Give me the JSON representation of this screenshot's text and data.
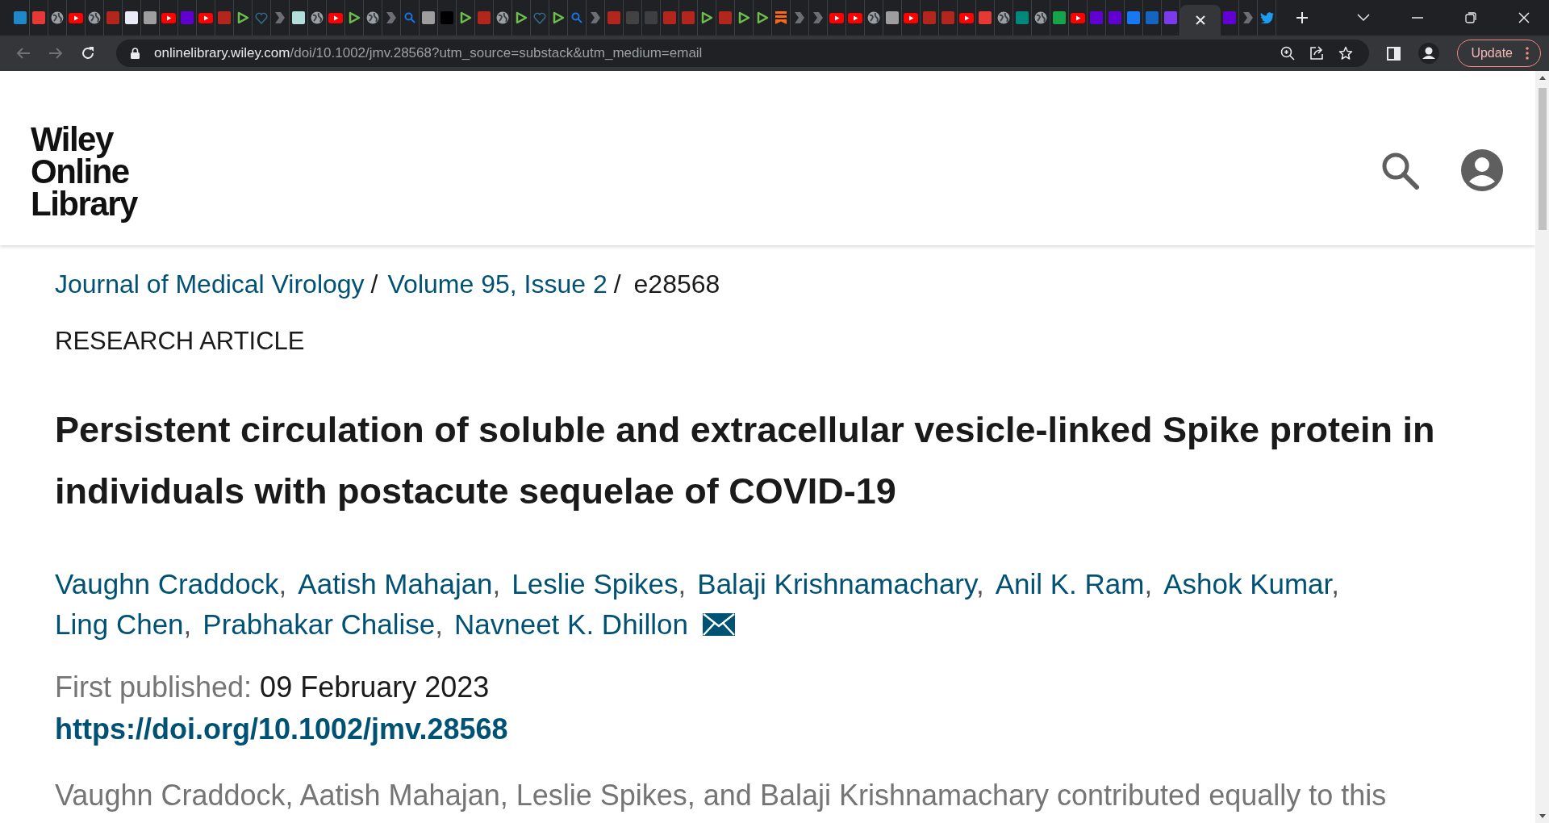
{
  "tabs": [
    {
      "kind": "tile",
      "color": "#1e88c8",
      "selected": false
    },
    {
      "kind": "tile",
      "color": "#e53935",
      "selected": false
    },
    {
      "kind": "globe",
      "selected": false
    },
    {
      "kind": "video",
      "selected": false
    },
    {
      "kind": "globe",
      "selected": false
    },
    {
      "kind": "tile",
      "color": "#b3261e",
      "selected": false
    },
    {
      "kind": "tile",
      "color": "#e8eaf6",
      "selected": false
    },
    {
      "kind": "tile",
      "color": "#9e9e9e",
      "selected": false
    },
    {
      "kind": "video",
      "selected": false
    },
    {
      "kind": "tile",
      "color": "#6001d2",
      "selected": false
    },
    {
      "kind": "video",
      "selected": false
    },
    {
      "kind": "tile",
      "color": "#b3261e",
      "selected": false
    },
    {
      "kind": "play",
      "selected": false
    },
    {
      "kind": "heart",
      "selected": false
    },
    {
      "kind": "chevron",
      "selected": false
    },
    {
      "kind": "tile",
      "color": "#b2dfdb",
      "selected": false
    },
    {
      "kind": "globe",
      "selected": false
    },
    {
      "kind": "video",
      "selected": false
    },
    {
      "kind": "play",
      "selected": false
    },
    {
      "kind": "globe",
      "selected": false
    },
    {
      "kind": "chevron",
      "selected": false
    },
    {
      "kind": "magnifier",
      "selected": false
    },
    {
      "kind": "tile",
      "color": "#9e9e9e",
      "selected": false
    },
    {
      "kind": "tile",
      "color": "#000000",
      "selected": false
    },
    {
      "kind": "play",
      "selected": false
    },
    {
      "kind": "tile",
      "color": "#b3261e",
      "selected": false
    },
    {
      "kind": "globe",
      "selected": false
    },
    {
      "kind": "play",
      "selected": false
    },
    {
      "kind": "heart",
      "selected": false
    },
    {
      "kind": "play",
      "selected": false
    },
    {
      "kind": "magnifier",
      "selected": false
    },
    {
      "kind": "chevron",
      "selected": false
    },
    {
      "kind": "tile",
      "color": "#b3261e",
      "selected": false
    },
    {
      "kind": "tile",
      "color": "#424242",
      "selected": false
    },
    {
      "kind": "tile",
      "color": "#3c4043",
      "selected": false
    },
    {
      "kind": "tile",
      "color": "#b3261e",
      "selected": false
    },
    {
      "kind": "tile",
      "color": "#b3261e",
      "selected": false
    },
    {
      "kind": "play",
      "selected": false
    },
    {
      "kind": "tile",
      "color": "#b3261e",
      "selected": false
    },
    {
      "kind": "play",
      "selected": false
    },
    {
      "kind": "play",
      "selected": false
    },
    {
      "kind": "bookmark",
      "selected": false
    },
    {
      "kind": "chevron",
      "selected": false
    },
    {
      "kind": "chevron",
      "selected": false
    },
    {
      "kind": "video",
      "selected": false
    },
    {
      "kind": "video",
      "selected": false
    },
    {
      "kind": "globe",
      "selected": false
    },
    {
      "kind": "tile",
      "color": "#9e9e9e",
      "selected": false
    },
    {
      "kind": "video",
      "selected": false
    },
    {
      "kind": "tile",
      "color": "#b3261e",
      "selected": false
    },
    {
      "kind": "tile",
      "color": "#b3261e",
      "selected": false
    },
    {
      "kind": "video",
      "selected": false
    },
    {
      "kind": "tile",
      "color": "#e53935",
      "selected": false
    },
    {
      "kind": "globe",
      "selected": false
    },
    {
      "kind": "tile",
      "color": "#00897b",
      "selected": false
    },
    {
      "kind": "globe",
      "selected": false
    },
    {
      "kind": "tile",
      "color": "#16a34a",
      "selected": false
    },
    {
      "kind": "video",
      "selected": false
    },
    {
      "kind": "tile",
      "color": "#6001d2",
      "selected": false
    },
    {
      "kind": "tile",
      "color": "#6001d2",
      "selected": false
    },
    {
      "kind": "tile",
      "color": "#1877f2",
      "selected": false
    },
    {
      "kind": "tile",
      "color": "#1565c0",
      "selected": false
    },
    {
      "kind": "tile",
      "color": "#7c3aed",
      "selected": false
    },
    {
      "kind": "active",
      "selected": true
    },
    {
      "kind": "tile",
      "color": "#6001d2",
      "selected": false
    },
    {
      "kind": "chevron",
      "selected": false
    },
    {
      "kind": "bird",
      "selected": false
    }
  ],
  "address_bar": {
    "host": "onlinelibrary.wiley.com",
    "path": "/doi/10.1002/jmv.28568?utm_source=substack&utm_medium=email"
  },
  "update_button": "Update",
  "logo": [
    "Wiley",
    "Online",
    "Library"
  ],
  "breadcrumb": {
    "links": [
      "Journal of Medical Virology",
      "Volume 95, Issue 2"
    ],
    "current": "e28568",
    "separator": "/"
  },
  "article_type": "RESEARCH ARTICLE",
  "title": "Persistent circulation of soluble and extracellular vesicle-linked Spike protein in individuals with postacute sequelae of COVID-19",
  "authors": [
    {
      "name": "Vaughn Craddock",
      "separator": ","
    },
    {
      "name": "Aatish Mahajan",
      "separator": ","
    },
    {
      "name": "Leslie Spikes",
      "separator": ","
    },
    {
      "name": "Balaji Krishnamachary",
      "separator": ","
    },
    {
      "name": "Anil K. Ram",
      "separator": ","
    },
    {
      "name": "Ashok Kumar",
      "separator": ","
    },
    {
      "name": "Ling Chen",
      "separator": ","
    },
    {
      "name": "Prabhakar Chalise",
      "separator": ","
    },
    {
      "name": "Navneet K. Dhillon"
    }
  ],
  "first_published": {
    "label": "First published:",
    "date": "09 February 2023"
  },
  "doi": "https://doi.org/10.1002/jmv.28568",
  "note": "Vaughn Craddock, Aatish Mahajan, Leslie Spikes, and Balaji Krishnamachary contributed equally to this"
}
